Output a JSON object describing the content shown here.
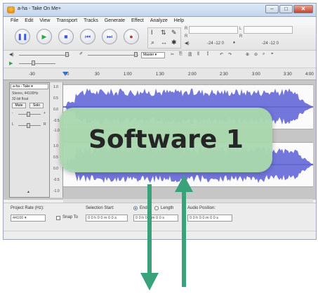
{
  "window": {
    "title": "a-ha - Take On Me+"
  },
  "menu": [
    "File",
    "Edit",
    "View",
    "Transport",
    "Tracks",
    "Generate",
    "Effect",
    "Analyze",
    "Help"
  ],
  "meters": {
    "record_scale": "-24  -12  0",
    "play_scale": "-24  -12  0",
    "left": "L",
    "right": "R"
  },
  "device": {
    "host": "Master"
  },
  "ruler": {
    "ticks": [
      "-30",
      "0",
      "30",
      "1:00",
      "1:30",
      "2:00",
      "2:30",
      "3:00",
      "3:30",
      "4:00"
    ]
  },
  "track": {
    "name": "a-ha - Take",
    "info1": "Stereo, 44100Hz",
    "info2": "32-bit float",
    "mute": "Mute",
    "solo": "Solo",
    "gain_minus": "-",
    "gain_plus": "+",
    "pan_left": "L",
    "pan_right": "R",
    "scale_top": [
      "1.0",
      "0.5",
      "0.0",
      "-0.5",
      "-1.0"
    ],
    "scale_bottom": [
      "1.0",
      "0.5",
      "0.0",
      "-0.5",
      "-1.0"
    ]
  },
  "selection": {
    "project_rate_label": "Project Rate (Hz):",
    "project_rate": "44100",
    "snap_to": "Snap To",
    "selection_start": "Selection Start:",
    "end": "End",
    "length": "Length",
    "audio_position": "Audio Position:",
    "time_start": "0 0 h 0 0 m 0 0 s",
    "time_end": "0 0 h 0 0 m 0 0 s",
    "time_audio": "0 0 h 0 0 m 0 0 s"
  },
  "overlay": {
    "label": "Software 1"
  },
  "colors": {
    "label_bg": "#a9d8ae",
    "arrow": "#3aa27a",
    "wave": "#5a5fd6"
  }
}
